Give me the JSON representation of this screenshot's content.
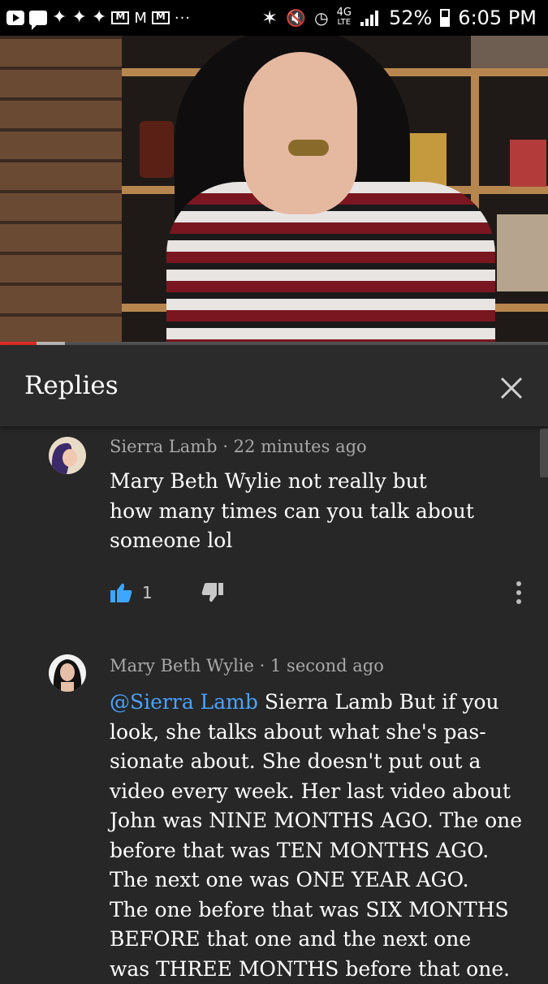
{
  "status_bar": {
    "battery_percent": "52%",
    "time": "6:05 PM",
    "network": "4G",
    "network_sub": "LTE",
    "notification_icons": [
      "youtube-icon",
      "message-icon",
      "twitter-icon",
      "twitter-icon",
      "twitter-icon",
      "gmail-icon",
      "gmail-icon",
      "gmail-icon"
    ],
    "gmail_letter": "M",
    "more": "···"
  },
  "video": {
    "progress_fraction": 0.07,
    "progress_color": "#e52d27"
  },
  "panel": {
    "title": "Replies",
    "close_icon": "close-icon"
  },
  "comments": [
    {
      "author": "Sierra Lamb",
      "time": "22 minutes ago",
      "text_lines": [
        "Mary Beth Wylie not really but",
        "how many times can you talk about",
        "someone lol"
      ],
      "likes": "1"
    },
    {
      "author": "Mary Beth Wylie",
      "time": "1 second ago",
      "mention": "@Sierra Lamb",
      "text_first": " Sierra Lamb  But if you",
      "text_lines": [
        "look, she talks about what she's pas-",
        "sionate about. She doesn't put out a",
        "video every week. Her last video about",
        "John was NINE MONTHS AGO. The one",
        "before that was TEN MONTHS AGO.",
        "The next one was ONE YEAR AGO.",
        "The one before that was SIX MONTHS",
        "BEFORE that one and the next one",
        "was THREE MONTHS before that one."
      ]
    }
  ],
  "colors": {
    "background": "#272727",
    "link": "#4aa3ff",
    "like_active": "#3ea6ff"
  }
}
